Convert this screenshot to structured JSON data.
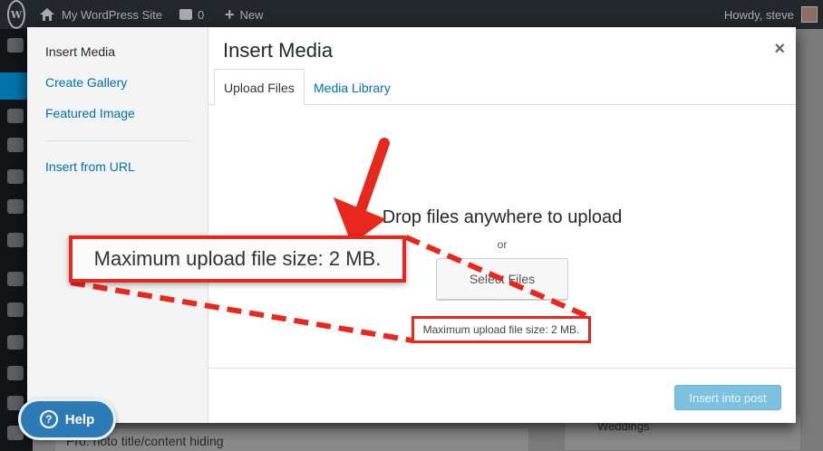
{
  "admin_bar": {
    "site_name": "My WordPress Site",
    "comments_count": "0",
    "new_label": "New",
    "howdy": "Howdy, steve"
  },
  "modal": {
    "title": "Insert Media",
    "close_symbol": "×",
    "menu": {
      "items": [
        {
          "label": "Insert Media",
          "current": true
        },
        {
          "label": "Create Gallery"
        },
        {
          "label": "Featured Image"
        },
        {
          "label": "Insert from URL"
        }
      ]
    },
    "tabs": [
      {
        "label": "Upload Files",
        "active": true
      },
      {
        "label": "Media Library"
      }
    ],
    "upload": {
      "drop_text": "Drop files anywhere to upload",
      "or_text": "or",
      "select_label": "Select Files",
      "max_size": "Maximum upload file size: 2 MB."
    },
    "toolbar": {
      "insert_label": "Insert into post"
    }
  },
  "annotation": {
    "callout_text": "Maximum upload file size: 2 MB.",
    "color": "#e8281d"
  },
  "background": {
    "left_box_text": "Pro: hoto title/content hiding",
    "right_box_text": "Weddings"
  },
  "help": {
    "label": "Help",
    "icon_glyph": "?"
  },
  "colors": {
    "admin_bar": "#23282d",
    "link": "#0073aa",
    "primary_button": "#7cc2e0",
    "help_button": "#2d7bb6"
  }
}
